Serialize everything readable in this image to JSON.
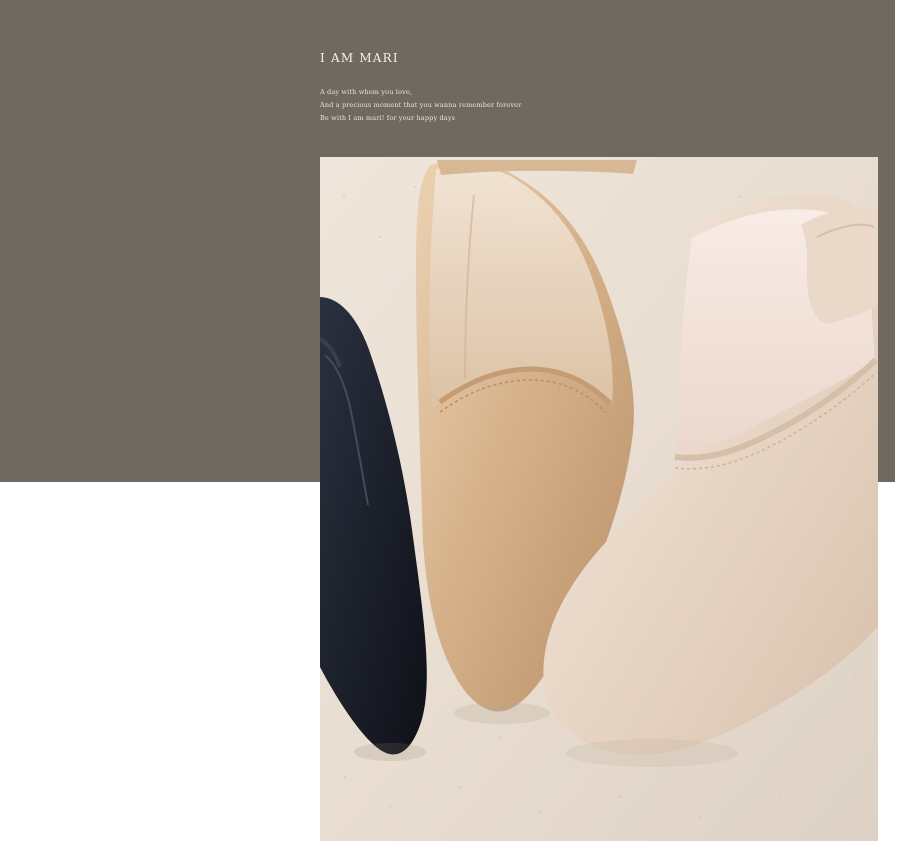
{
  "header": {
    "brand": "I AM MARI",
    "tagline_lines": [
      "A day with whom you love,",
      "And a precious moment that you wanna remember forever",
      "Be with I am mari! for your happy days"
    ]
  },
  "colors": {
    "panel": "#706960",
    "background": "#ffffff",
    "floor": "#e8ddd1",
    "shoe_black": "#171b26",
    "shoe_tan": "#d4b28a",
    "shoe_nude": "#ead8c8"
  },
  "image": {
    "subject": "three pointed-toe Mary Jane flats in black, tan, and nude on a speckled floor"
  }
}
